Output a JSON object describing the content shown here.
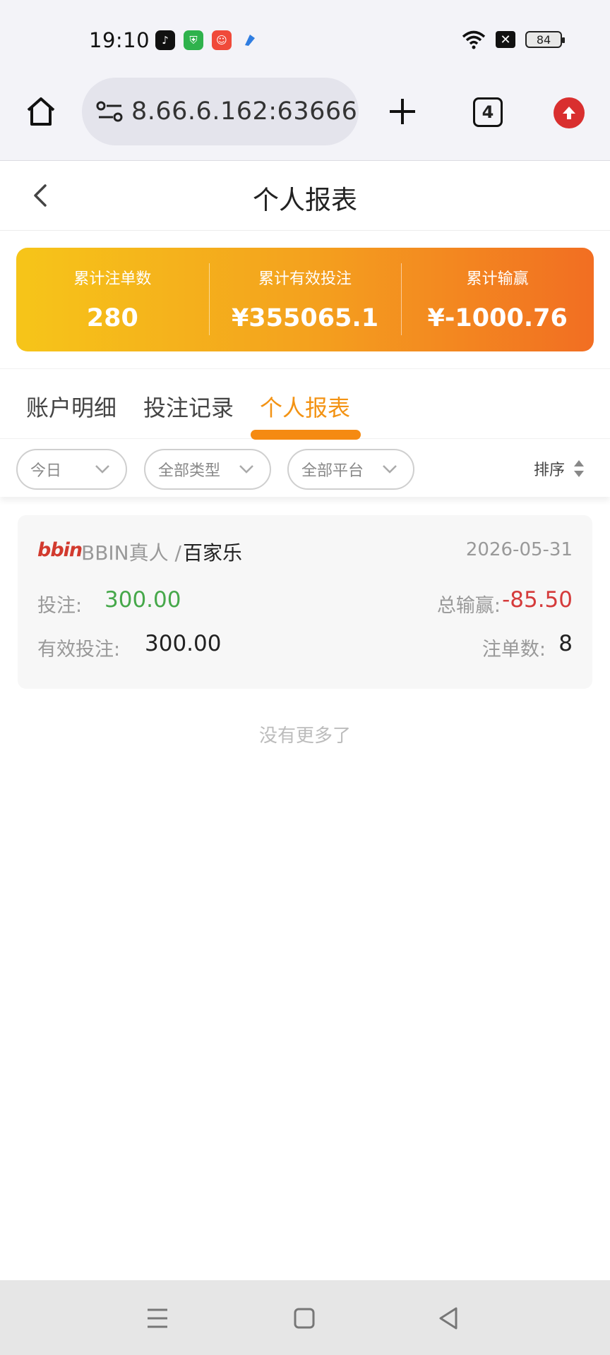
{
  "status_bar": {
    "time": "19:10",
    "battery": "84",
    "icons": [
      "tiktok-icon",
      "shield-app-icon",
      "people-app-icon",
      "blue-app-icon",
      "wifi-icon",
      "no-sim-icon",
      "battery-icon"
    ]
  },
  "browser": {
    "url": "​8.66.6.162:63666",
    "tab_count": "4"
  },
  "header": {
    "title": "个人报表"
  },
  "summary": {
    "items": [
      {
        "label": "累计注单数",
        "value": "280"
      },
      {
        "label": "累计有效投注",
        "value": "¥355065.1"
      },
      {
        "label": "累计输赢",
        "value": "¥-1000.76"
      }
    ]
  },
  "tabs": [
    {
      "label": "账户明细",
      "active": false
    },
    {
      "label": "投注记录",
      "active": false
    },
    {
      "label": "个人报表",
      "active": true
    }
  ],
  "filters": {
    "date": "今日",
    "type": "全部类型",
    "platform": "全部平台",
    "sort": "排序"
  },
  "records": [
    {
      "logo": "bbin",
      "provider": "BBIN真人 /",
      "game": "百家乐",
      "date": "2026-05-31",
      "bet_label": "投注:",
      "bet": "300.00",
      "winloss_label": "总输赢:",
      "winloss": "-85.50",
      "valid_bet_label": "有效投注:",
      "valid_bet": "300.00",
      "count_label": "注单数:",
      "count": "8"
    }
  ],
  "footer_text": "没有更多了",
  "colors": {
    "accent": "#f39314",
    "positive": "#46a84a",
    "negative": "#d53b3b",
    "gradient_start": "#f6c519",
    "gradient_end": "#f26e22"
  }
}
